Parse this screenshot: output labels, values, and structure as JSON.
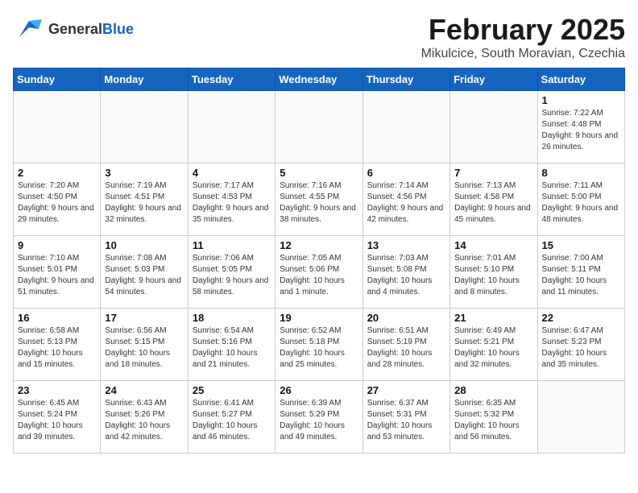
{
  "header": {
    "logo_general": "General",
    "logo_blue": "Blue",
    "title": "February 2025",
    "subtitle": "Mikulcice, South Moravian, Czechia"
  },
  "days_of_week": [
    "Sunday",
    "Monday",
    "Tuesday",
    "Wednesday",
    "Thursday",
    "Friday",
    "Saturday"
  ],
  "weeks": [
    [
      {
        "day": "",
        "info": ""
      },
      {
        "day": "",
        "info": ""
      },
      {
        "day": "",
        "info": ""
      },
      {
        "day": "",
        "info": ""
      },
      {
        "day": "",
        "info": ""
      },
      {
        "day": "",
        "info": ""
      },
      {
        "day": "1",
        "info": "Sunrise: 7:22 AM\nSunset: 4:48 PM\nDaylight: 9 hours and 26 minutes."
      }
    ],
    [
      {
        "day": "2",
        "info": "Sunrise: 7:20 AM\nSunset: 4:50 PM\nDaylight: 9 hours and 29 minutes."
      },
      {
        "day": "3",
        "info": "Sunrise: 7:19 AM\nSunset: 4:51 PM\nDaylight: 9 hours and 32 minutes."
      },
      {
        "day": "4",
        "info": "Sunrise: 7:17 AM\nSunset: 4:53 PM\nDaylight: 9 hours and 35 minutes."
      },
      {
        "day": "5",
        "info": "Sunrise: 7:16 AM\nSunset: 4:55 PM\nDaylight: 9 hours and 38 minutes."
      },
      {
        "day": "6",
        "info": "Sunrise: 7:14 AM\nSunset: 4:56 PM\nDaylight: 9 hours and 42 minutes."
      },
      {
        "day": "7",
        "info": "Sunrise: 7:13 AM\nSunset: 4:58 PM\nDaylight: 9 hours and 45 minutes."
      },
      {
        "day": "8",
        "info": "Sunrise: 7:11 AM\nSunset: 5:00 PM\nDaylight: 9 hours and 48 minutes."
      }
    ],
    [
      {
        "day": "9",
        "info": "Sunrise: 7:10 AM\nSunset: 5:01 PM\nDaylight: 9 hours and 51 minutes."
      },
      {
        "day": "10",
        "info": "Sunrise: 7:08 AM\nSunset: 5:03 PM\nDaylight: 9 hours and 54 minutes."
      },
      {
        "day": "11",
        "info": "Sunrise: 7:06 AM\nSunset: 5:05 PM\nDaylight: 9 hours and 58 minutes."
      },
      {
        "day": "12",
        "info": "Sunrise: 7:05 AM\nSunset: 5:06 PM\nDaylight: 10 hours and 1 minute."
      },
      {
        "day": "13",
        "info": "Sunrise: 7:03 AM\nSunset: 5:08 PM\nDaylight: 10 hours and 4 minutes."
      },
      {
        "day": "14",
        "info": "Sunrise: 7:01 AM\nSunset: 5:10 PM\nDaylight: 10 hours and 8 minutes."
      },
      {
        "day": "15",
        "info": "Sunrise: 7:00 AM\nSunset: 5:11 PM\nDaylight: 10 hours and 11 minutes."
      }
    ],
    [
      {
        "day": "16",
        "info": "Sunrise: 6:58 AM\nSunset: 5:13 PM\nDaylight: 10 hours and 15 minutes."
      },
      {
        "day": "17",
        "info": "Sunrise: 6:56 AM\nSunset: 5:15 PM\nDaylight: 10 hours and 18 minutes."
      },
      {
        "day": "18",
        "info": "Sunrise: 6:54 AM\nSunset: 5:16 PM\nDaylight: 10 hours and 21 minutes."
      },
      {
        "day": "19",
        "info": "Sunrise: 6:52 AM\nSunset: 5:18 PM\nDaylight: 10 hours and 25 minutes."
      },
      {
        "day": "20",
        "info": "Sunrise: 6:51 AM\nSunset: 5:19 PM\nDaylight: 10 hours and 28 minutes."
      },
      {
        "day": "21",
        "info": "Sunrise: 6:49 AM\nSunset: 5:21 PM\nDaylight: 10 hours and 32 minutes."
      },
      {
        "day": "22",
        "info": "Sunrise: 6:47 AM\nSunset: 5:23 PM\nDaylight: 10 hours and 35 minutes."
      }
    ],
    [
      {
        "day": "23",
        "info": "Sunrise: 6:45 AM\nSunset: 5:24 PM\nDaylight: 10 hours and 39 minutes."
      },
      {
        "day": "24",
        "info": "Sunrise: 6:43 AM\nSunset: 5:26 PM\nDaylight: 10 hours and 42 minutes."
      },
      {
        "day": "25",
        "info": "Sunrise: 6:41 AM\nSunset: 5:27 PM\nDaylight: 10 hours and 46 minutes."
      },
      {
        "day": "26",
        "info": "Sunrise: 6:39 AM\nSunset: 5:29 PM\nDaylight: 10 hours and 49 minutes."
      },
      {
        "day": "27",
        "info": "Sunrise: 6:37 AM\nSunset: 5:31 PM\nDaylight: 10 hours and 53 minutes."
      },
      {
        "day": "28",
        "info": "Sunrise: 6:35 AM\nSunset: 5:32 PM\nDaylight: 10 hours and 56 minutes."
      },
      {
        "day": "",
        "info": ""
      }
    ]
  ]
}
